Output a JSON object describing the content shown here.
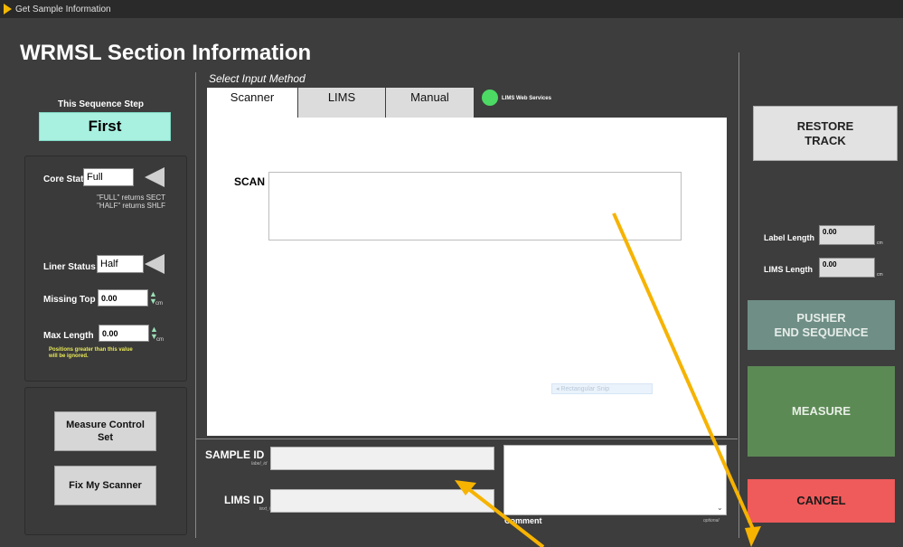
{
  "window": {
    "title": "Get Sample Information"
  },
  "heading": "WRMSL Section Information",
  "sequence": {
    "label": "This Sequence Step",
    "value": "First"
  },
  "core_status": {
    "label": "Core Status",
    "value": "Full",
    "note1": "\"FULL\" returns SECT",
    "note2": "\"HALF\" returns SHLF"
  },
  "liner_status": {
    "label": "Liner Status",
    "value": "Half"
  },
  "missing_top": {
    "label": "Missing Top",
    "value": "0.00",
    "unit": "cm"
  },
  "max_length": {
    "label": "Max Length",
    "value": "0.00",
    "unit": "cm",
    "note1": "Positions greater than this value",
    "note2": "will be ignored."
  },
  "buttons": {
    "measure_control_1": "Measure Control",
    "measure_control_2": "Set",
    "fix_scanner": "Fix My Scanner"
  },
  "input_method": {
    "label": "Select Input Method",
    "tabs": [
      "Scanner",
      "LIMS",
      "Manual"
    ],
    "active_tab": "Scanner",
    "lims_indicator": "LIMS Web Services",
    "scan_label": "SCAN",
    "snip_hint": "Rectangular Snip"
  },
  "sample_id": {
    "label": "SAMPLE ID",
    "sub": "label_id",
    "value": ""
  },
  "lims_id": {
    "label": "LIMS ID",
    "sub": "text_id",
    "value": ""
  },
  "comment": {
    "label": "Comment",
    "optional": "optional",
    "value": ""
  },
  "right": {
    "restore_1": "RESTORE",
    "restore_2": "TRACK",
    "label_length": {
      "label": "Label Length",
      "value": "0.00",
      "unit": "cm"
    },
    "lims_length": {
      "label": "LIMS Length",
      "value": "0.00",
      "unit": "cm"
    },
    "pusher_1": "PUSHER",
    "pusher_2": "END SEQUENCE",
    "measure": "MEASURE",
    "cancel": "CANCEL"
  },
  "colors": {
    "sequence_bg": "#a8f0e0",
    "indicator": "#4cd964",
    "pusher": "#6f8f86",
    "measure": "#5c8a55",
    "cancel": "#ef5a5a",
    "annotation": "#f6b300"
  }
}
